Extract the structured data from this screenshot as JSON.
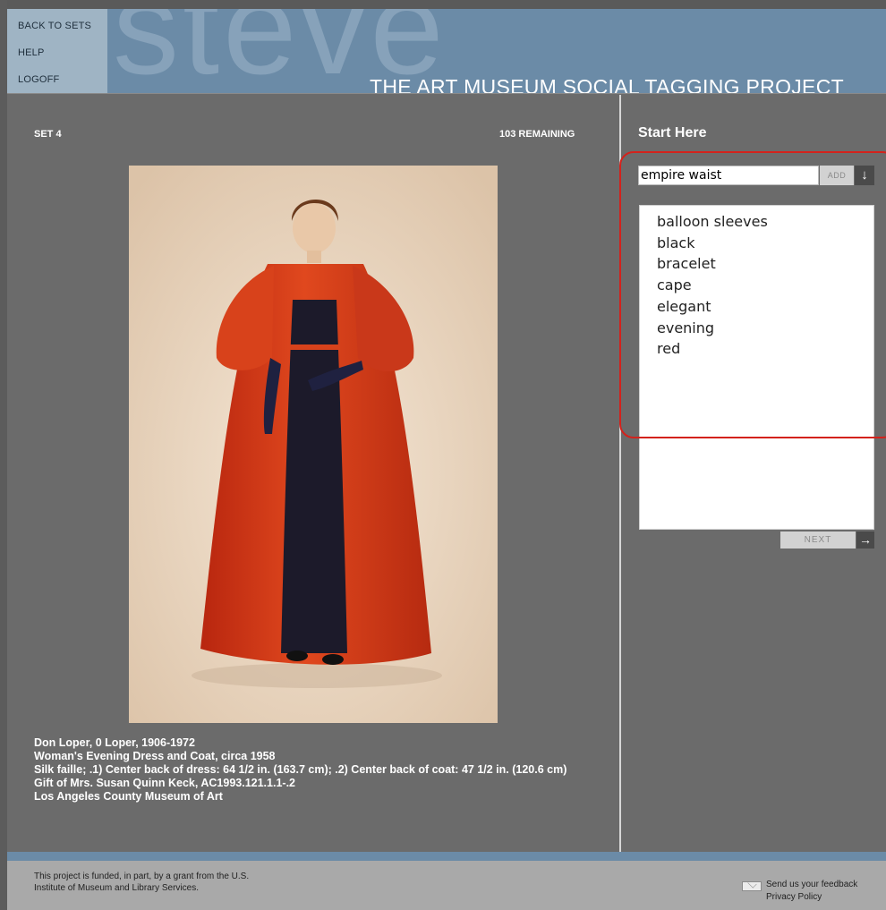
{
  "nav": {
    "back_to_sets": "BACK TO SETS",
    "help": "HELP",
    "logoff": "LOGOFF"
  },
  "header": {
    "logo": "steve",
    "tagline": "THE ART MUSEUM SOCIAL TAGGING PROJECT"
  },
  "set": {
    "label": "SET 4",
    "remaining": "103 REMAINING"
  },
  "artwork": {
    "caption": [
      "Don Loper, 0 Loper, 1906-1972",
      "Woman's Evening Dress and Coat, circa 1958",
      "Silk faille; .1) Center back of dress: 64 1/2 in. (163.7 cm); .2) Center back of coat: 47 1/2 in. (120.6 cm)",
      "Gift of Mrs. Susan Quinn Keck, AC1993.121.1.1-.2",
      "Los Angeles County Museum of Art"
    ]
  },
  "tagging": {
    "heading": "Start Here",
    "input_value": "empire waist",
    "add_label": "ADD",
    "add_arrow": "↓",
    "tags": [
      "balloon sleeves",
      "black",
      "bracelet",
      "cape",
      "elegant",
      "evening",
      "red"
    ],
    "next_label": "NEXT",
    "next_arrow": "→"
  },
  "footer": {
    "funding_line1": "This project is funded, in part, by a grant from the U.S.",
    "funding_line2": "Institute of Museum and Library Services.",
    "feedback": "Send us your feedback",
    "privacy": "Privacy Policy"
  },
  "colors": {
    "background": "#6b6b6b",
    "banner": "#6b8ba7",
    "nav": "#9fb4c4",
    "highlight": "#d3221c",
    "garment": "#d13a1a"
  }
}
